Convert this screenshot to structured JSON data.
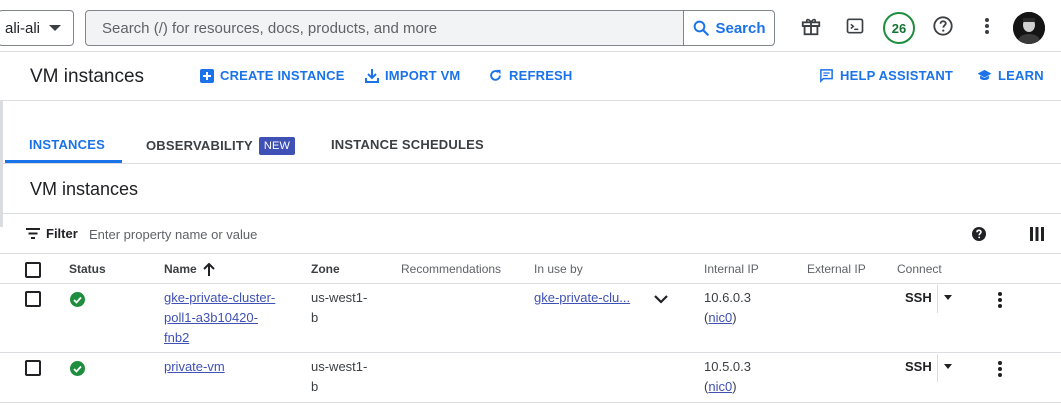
{
  "topbar": {
    "project": "ali-ali",
    "search_placeholder": "Search (/) for resources, docs, products, and more",
    "search_button": "Search",
    "notifications_count": "26"
  },
  "header": {
    "title": "VM instances",
    "create_instance": "CREATE INSTANCE",
    "import_vm": "IMPORT VM",
    "refresh": "REFRESH",
    "help_assistant": "HELP ASSISTANT",
    "learn": "LEARN"
  },
  "tabs": {
    "instances": "INSTANCES",
    "observability": "OBSERVABILITY",
    "observability_badge": "NEW",
    "instance_schedules": "INSTANCE SCHEDULES"
  },
  "section": {
    "title": "VM instances"
  },
  "filter": {
    "label": "Filter",
    "placeholder": "Enter property name or value"
  },
  "table": {
    "columns": {
      "status": "Status",
      "name": "Name",
      "zone": "Zone",
      "recommendations": "Recommendations",
      "in_use_by": "In use by",
      "internal_ip": "Internal IP",
      "external_ip": "External IP",
      "connect": "Connect"
    },
    "rows": [
      {
        "name_line1": "gke-private-cluster-",
        "name_line2": "poll1-a3b10420-",
        "name_line3": "fnb2",
        "zone_line1": "us-west1-",
        "zone_line2": "b",
        "in_use_by": "gke-private-clu...",
        "internal_ip": "10.6.0.3",
        "nic_open": "(",
        "nic": "nic0",
        "nic_close": ")",
        "connect": "SSH"
      },
      {
        "name_line1": "private-vm",
        "zone_line1": "us-west1-",
        "zone_line2": "b",
        "internal_ip": "10.5.0.3",
        "nic_open": "(",
        "nic": "nic0",
        "nic_close": ")",
        "connect": "SSH"
      }
    ]
  },
  "colors": {
    "accent": "#1a73e8",
    "link": "#3f51b5",
    "status_ok": "#1e8e3e"
  }
}
